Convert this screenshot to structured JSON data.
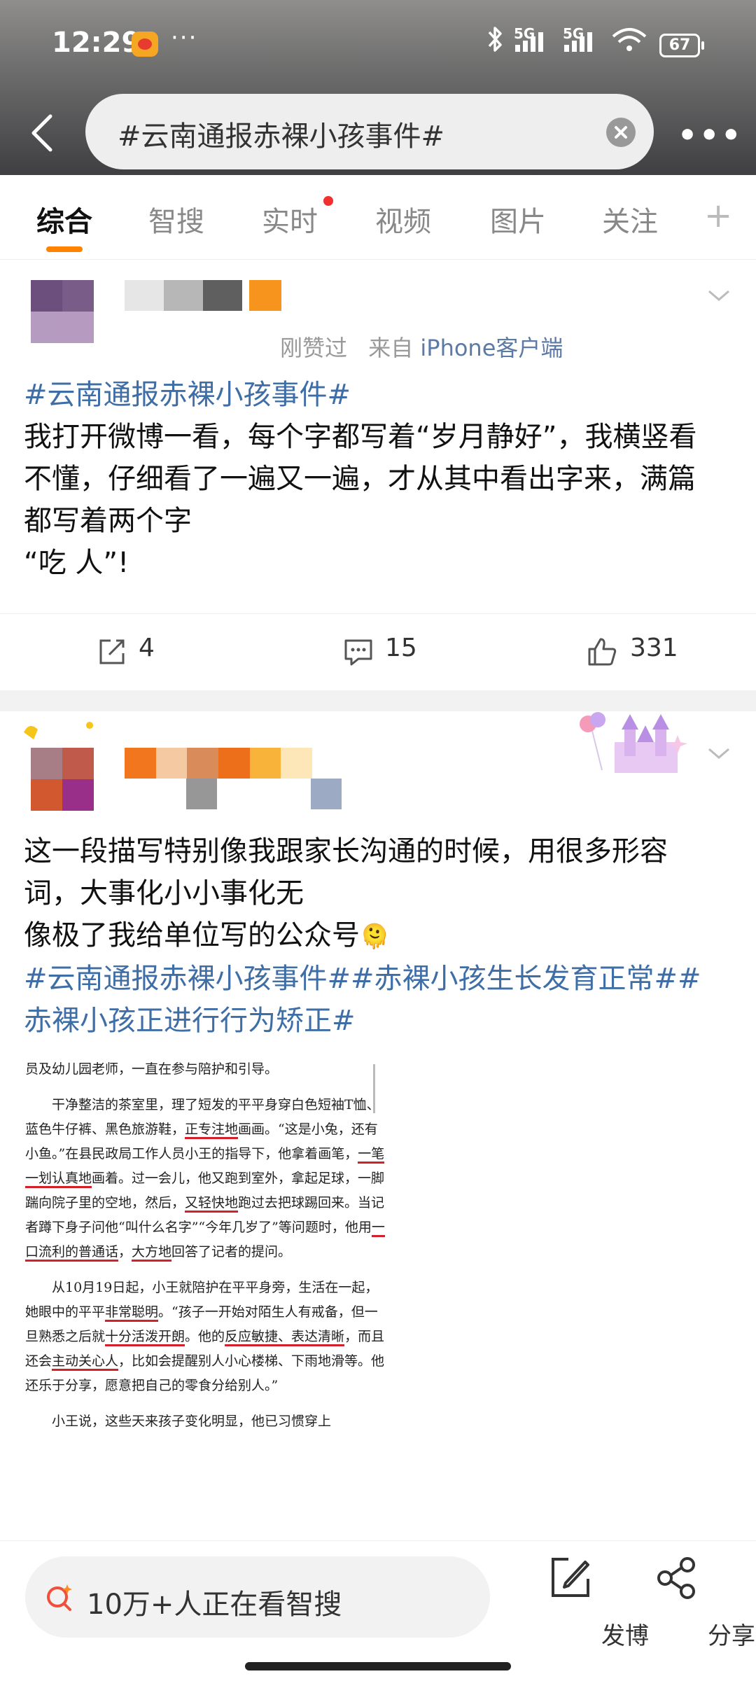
{
  "status_bar": {
    "time": "12:29",
    "more": "···",
    "network1": "5G",
    "network2": "5G",
    "battery": "67"
  },
  "search": {
    "query": "#云南通报赤裸小孩事件#",
    "more": "•••"
  },
  "tabs": [
    {
      "label": "综合"
    },
    {
      "label": "智搜"
    },
    {
      "label": "实时"
    },
    {
      "label": "视频"
    },
    {
      "label": "图片"
    },
    {
      "label": "关注"
    }
  ],
  "tabs_plus": "+",
  "post1": {
    "meta_liked": "刚赞过",
    "meta_from": "来自",
    "meta_source": "iPhone客户端",
    "hashtag": "#云南通报赤裸小孩事件#",
    "lines": [
      "我打开微博一看，每个字都写着“岁月静好”，我横竖看",
      "不懂，仔细看了一遍又一遍，才从其中看出字来，满篇",
      "都写着两个字",
      "“吃 人”!"
    ],
    "shares": "4",
    "comments": "15",
    "likes": "331"
  },
  "post2": {
    "lines": [
      "这一段描写特别像我跟家长沟通的时候，用很多形容",
      "词，大事化小小事化无",
      "像极了我给单位写的公众号"
    ],
    "emoji": "🫠",
    "hashtags_line1": "#云南通报赤裸小孩事件##赤裸小孩生长发育正常##",
    "hashtags_line2": "赤裸小孩正进行行为矫正#",
    "article": {
      "p0": "员及幼儿园老师，一直在参与陪护和引导。",
      "p1_a": "干净整洁的茶室里，理了短发的平平身穿白色短袖T恤、蓝色牛仔裤、黑色旅游鞋，",
      "p1_u1": "正专注地",
      "p1_b": "画画。“这是小兔，还有小鱼。”在县民政局工作人员小王的指导下，他拿着画笔，",
      "p1_u2": "一笔一划认真地",
      "p1_c": "画着。过一会儿，他又跑到室外，拿起足球，一脚踹向院子里的空地，然后，",
      "p1_u3": "又轻快地",
      "p1_d": "跑过去把球踢回来。当记者蹲下身子问他“叫什么名字”“今年几岁了”等问题时，他用",
      "p1_u4": "一口流利的普通话",
      "p1_e": "，",
      "p1_u5": "大方地",
      "p1_f": "回答了记者的提问。",
      "p2_a": "从10月19日起，小王就陪护在平平身旁，生活在一起，她眼中的平平",
      "p2_u1": "非常聪明",
      "p2_b": "。“孩子一开始对陌生人有戒备，但一旦熟悉之后就",
      "p2_u2": "十分活泼开朗",
      "p2_c": "。他的",
      "p2_u3": "反应敏捷、表达清晰",
      "p2_d": "，而且还会",
      "p2_u4": "主动关心人",
      "p2_e": "，比如会提醒别人小心楼梯、下雨地滑等。他还乐于分享，愿意把自己的零食分给别人。”",
      "p3": "小王说，这些天来孩子变化明显，他已习惯穿上"
    }
  },
  "bottom_bar": {
    "ai_text": "10万+人正在看智搜",
    "post_label": "发博",
    "share_label": "分享"
  },
  "colors": {
    "accent": "#ff8200",
    "link": "#3f6ea7",
    "underline": "#d4202a"
  }
}
